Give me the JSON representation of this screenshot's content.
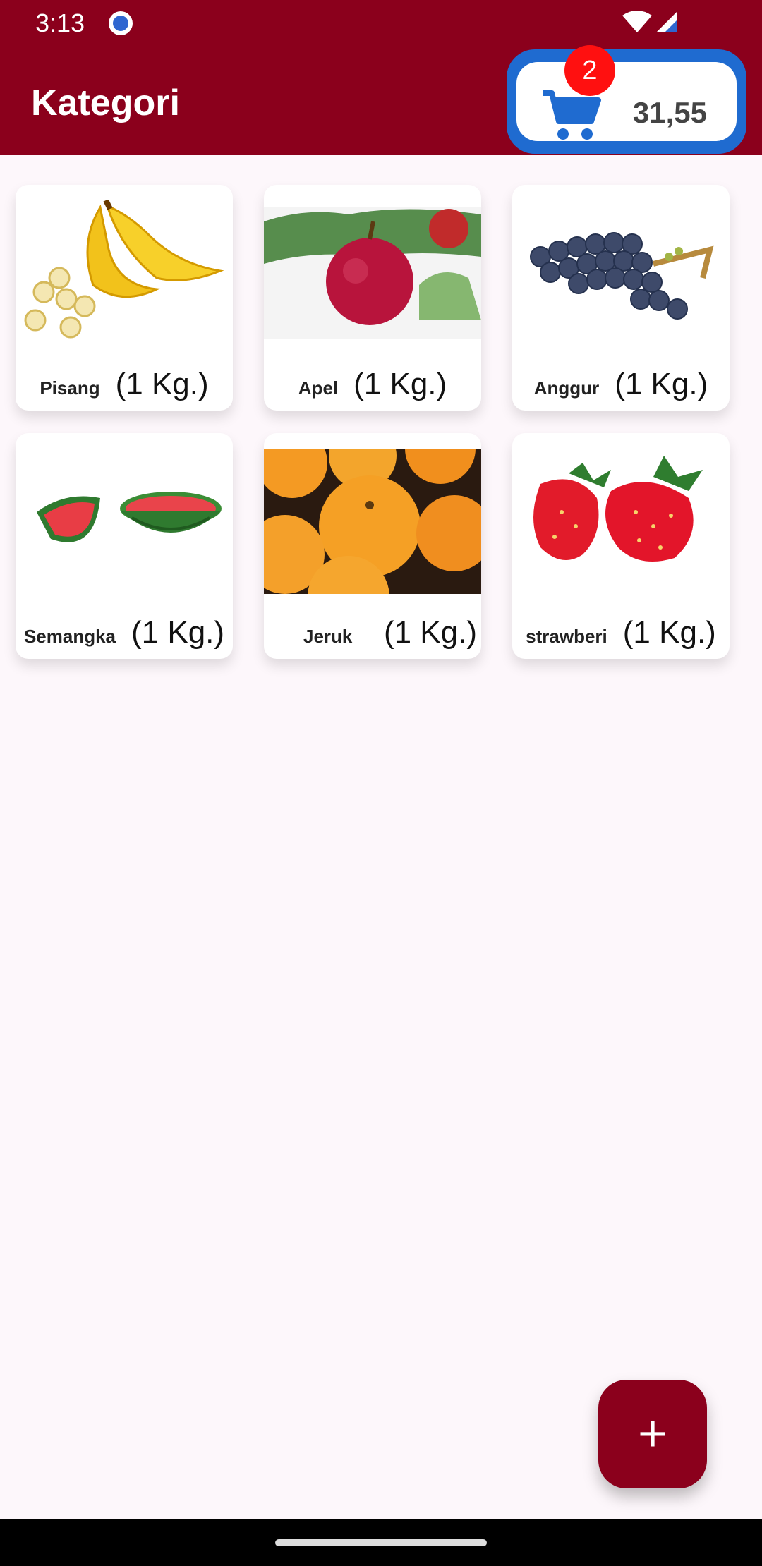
{
  "status_bar": {
    "time": "3:13"
  },
  "header": {
    "title": "Kategori"
  },
  "cart": {
    "count": "2",
    "total": "31,55"
  },
  "products": [
    {
      "name": "Pisang",
      "unit": "(1 Kg.)",
      "image": "banana"
    },
    {
      "name": "Apel",
      "unit": "(1 Kg.)",
      "image": "apple"
    },
    {
      "name": "Anggur",
      "unit": "(1 Kg.)",
      "image": "grapes"
    },
    {
      "name": "Semangka",
      "unit": "(1 Kg.)",
      "image": "watermelon"
    },
    {
      "name": "Jeruk",
      "unit": "(1 Kg.)",
      "image": "orange"
    },
    {
      "name": "strawberi",
      "unit": "(1 Kg.)",
      "image": "strawberry"
    }
  ],
  "fab": {
    "label": "+"
  },
  "colors": {
    "primary": "#8b001c",
    "cart_blue": "#1f6bd0",
    "badge_red": "#ff1010"
  }
}
